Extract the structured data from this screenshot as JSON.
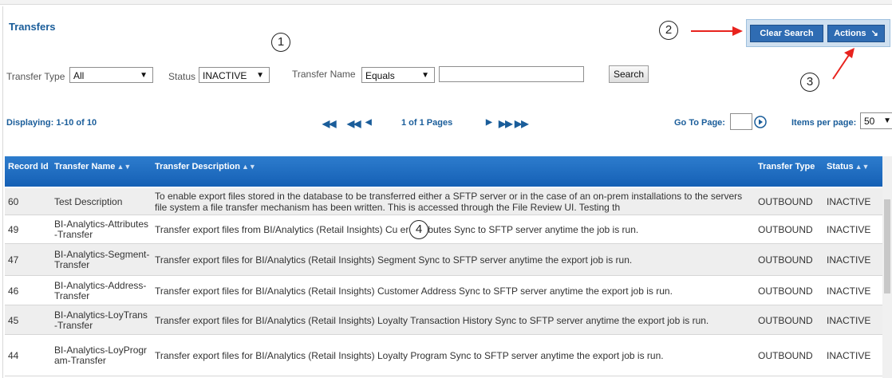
{
  "page_title": "Transfers",
  "actions": {
    "clear_search": "Clear Search",
    "actions_label": "Actions",
    "actions_icon": "arrow-down-right-icon"
  },
  "filters": {
    "transfer_type_label": "Transfer Type",
    "transfer_type_value": "All",
    "status_label": "Status",
    "status_value": "INACTIVE",
    "transfer_name_label": "Transfer Name",
    "transfer_name_operator": "Equals",
    "transfer_name_value": "",
    "search_label": "Search"
  },
  "pagination": {
    "displaying": "Displaying: 1-10 of 10",
    "page_info": "1 of 1 Pages",
    "go_to_page_label": "Go To Page:",
    "go_to_page_value": "",
    "items_per_page_label": "Items per page:",
    "items_per_page_value": "50"
  },
  "callouts": [
    "1",
    "2",
    "3",
    "4"
  ],
  "table": {
    "columns": [
      "Record Id",
      "Transfer Name",
      "Transfer Description",
      "Transfer Type",
      "Status"
    ],
    "rows": [
      {
        "id": "60",
        "name": "Test Description",
        "desc": "To enable export files stored in the database to be transferred either a SFTP server or in the case of an on-prem installations to the servers file system a file transfer mechanism has been written. This is accessed through the File Review UI. Testing th",
        "type": "OUTBOUND",
        "status": "INACTIVE"
      },
      {
        "id": "49",
        "name": "BI-Analytics-Attributes-Transfer",
        "desc": "Transfer export files from BI/Analytics (Retail Insights) Cu   er Attributes Sync to SFTP server anytime the job is run.",
        "type": "OUTBOUND",
        "status": "INACTIVE"
      },
      {
        "id": "47",
        "name": "BI-Analytics-Segment-Transfer",
        "desc": "Transfer export files for BI/Analytics (Retail Insights) Segment Sync to SFTP server anytime the export job is run.",
        "type": "OUTBOUND",
        "status": "INACTIVE"
      },
      {
        "id": "46",
        "name": "BI-Analytics-Address-Transfer",
        "desc": "Transfer export files for BI/Analytics (Retail Insights) Customer Address Sync to SFTP server anytime the export job is run.",
        "type": "OUTBOUND",
        "status": "INACTIVE"
      },
      {
        "id": "45",
        "name": "BI-Analytics-LoyTrans-Transfer",
        "desc": "Transfer export files for BI/Analytics (Retail Insights) Loyalty Transaction History Sync to SFTP server anytime the export job is run.",
        "type": "OUTBOUND",
        "status": "INACTIVE"
      },
      {
        "id": "44",
        "name": "BI-Analytics-LoyProgram-Transfer",
        "desc": "Transfer export files for BI/Analytics (Retail Insights) Loyalty Program Sync to SFTP server anytime the export job is run.",
        "type": "OUTBOUND",
        "status": "INACTIVE"
      }
    ]
  },
  "colors": {
    "header_blue": "#1f6cbf",
    "title_blue": "#1a5d9a",
    "button_blue": "#2f6cb3",
    "arrow_red": "#e8231e"
  }
}
